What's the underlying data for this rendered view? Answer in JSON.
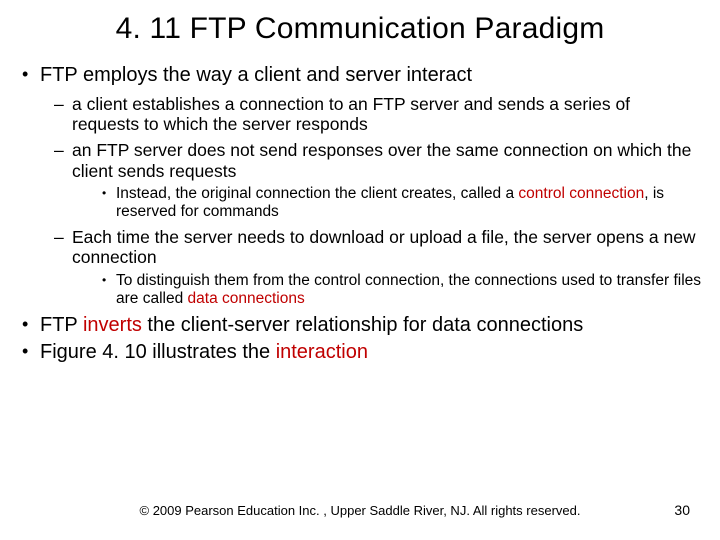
{
  "title": "4. 11  FTP Communication Paradigm",
  "b1": "FTP employs the way a client and server interact",
  "b1_1": "a client establishes a connection to an FTP server and sends a series of requests to which the server responds",
  "b1_2": "an FTP server does not send responses over the same connection on which the client sends requests",
  "b1_2_1a": "Instead, the original connection the client creates, called a ",
  "b1_2_1b": "control connection",
  "b1_2_1c": ", is reserved for commands",
  "b1_3": "Each time the server needs to download or upload a file, the server opens a new connection",
  "b1_3_1a": "To distinguish them from the control connection, the connections used to transfer files are called ",
  "b1_3_1b": "data connections",
  "b2a": "FTP ",
  "b2b": "inverts",
  "b2c": " the client-server relationship for data connections",
  "b3a": "Figure 4. 10 illustrates the ",
  "b3b": "interaction",
  "copyright": "© 2009 Pearson Education Inc. , Upper Saddle River, NJ. All rights reserved.",
  "pagenum": "30"
}
